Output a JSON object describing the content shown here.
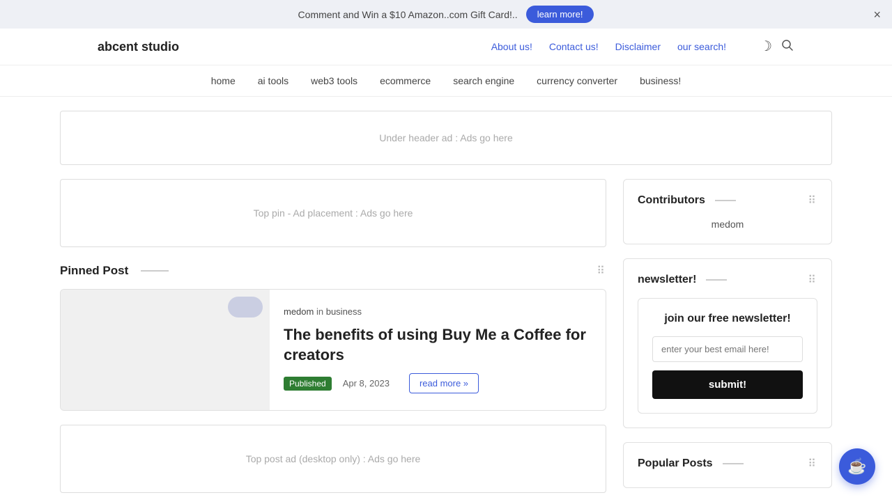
{
  "announcement": {
    "text": "Comment and Win a $10 Amazon..com Gift Card!..",
    "cta_label": "learn more!",
    "close_label": "×"
  },
  "header": {
    "logo": "abcent studio",
    "nav_links": [
      {
        "label": "About us!",
        "href": "#"
      },
      {
        "label": "Contact us!",
        "href": "#"
      },
      {
        "label": "Disclaimer",
        "href": "#"
      },
      {
        "label": "our search!",
        "href": "#"
      }
    ],
    "theme_icon": "☽",
    "search_icon": "⌕"
  },
  "secondary_nav": {
    "links": [
      {
        "label": "home"
      },
      {
        "label": "ai tools"
      },
      {
        "label": "web3 tools"
      },
      {
        "label": "ecommerce"
      },
      {
        "label": "search engine"
      },
      {
        "label": "currency converter"
      },
      {
        "label": "business!"
      }
    ]
  },
  "ad_banner": {
    "text": "Under header ad : Ads go here"
  },
  "top_pin_ad": {
    "text": "Top pin - Ad placement : Ads go here"
  },
  "pinned_post": {
    "section_title": "Pinned Post",
    "dots": "⋮⋮",
    "post": {
      "author": "medom",
      "category": "business",
      "title": "The benefits of using Buy Me a Coffee for creators",
      "status": "Published",
      "date": "Apr 8, 2023",
      "read_more": "read more »"
    }
  },
  "bottom_ad": {
    "text": "Top post ad (desktop only) : Ads go here"
  },
  "sidebar": {
    "contributors": {
      "title": "Contributors",
      "dots": "⋮⋮",
      "name": "medom"
    },
    "newsletter": {
      "title": "newsletter!",
      "dots": "⋮⋮",
      "inner_title": "join our free newsletter!",
      "email_placeholder": "enter your best email here!",
      "submit_label": "submit!"
    },
    "popular_posts": {
      "title": "Popular Posts",
      "dots": "⋮⋮"
    }
  },
  "float_button": {
    "icon": "☕"
  }
}
